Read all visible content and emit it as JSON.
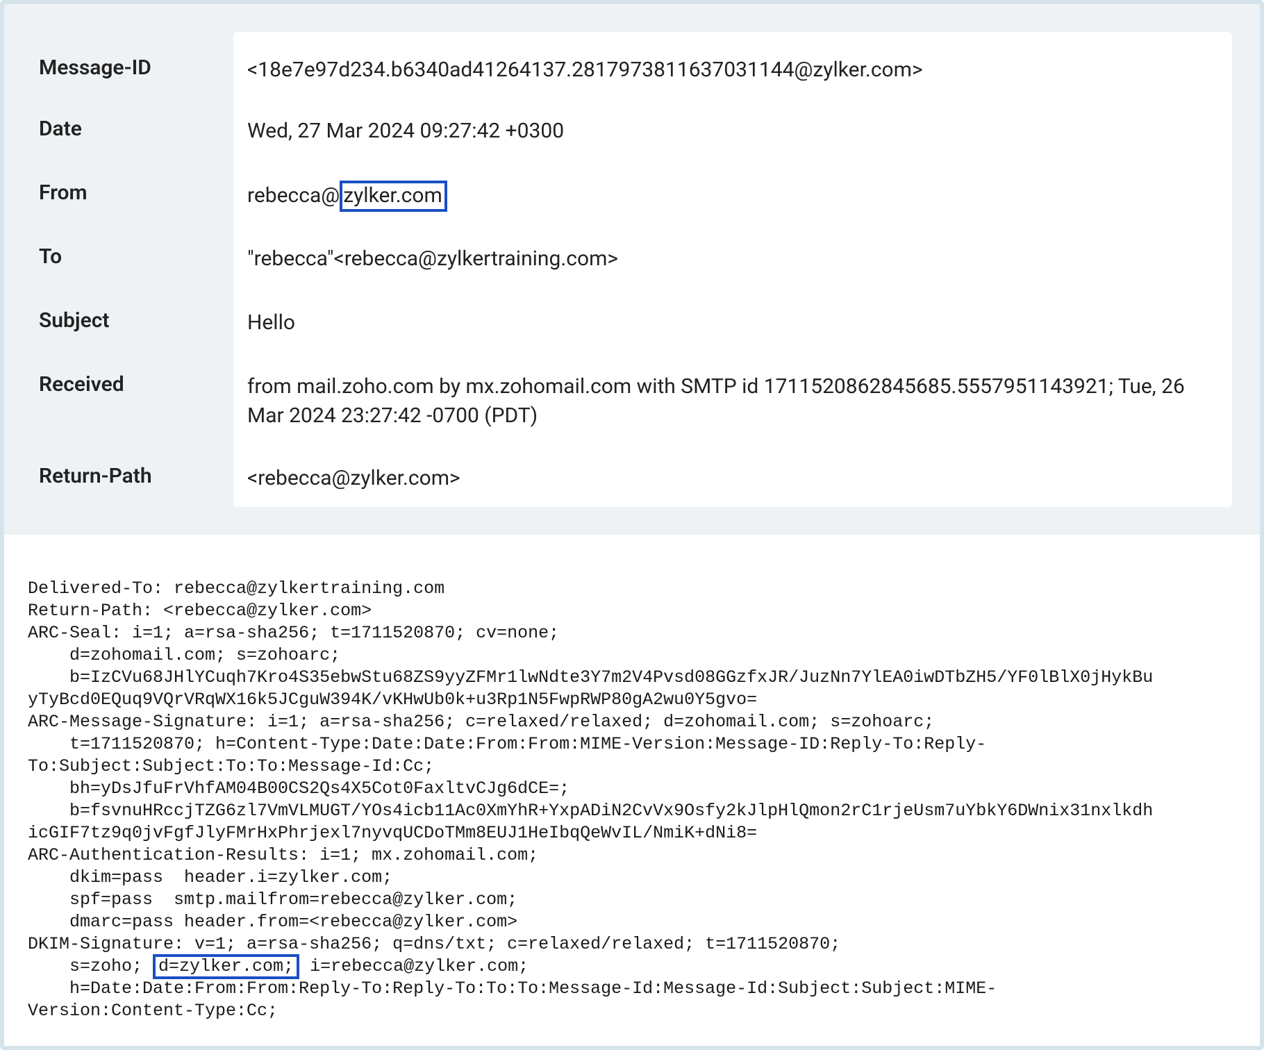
{
  "headers": {
    "message_id": {
      "label": "Message-ID",
      "value": "<18e7e97d234.b6340ad41264137.2817973811637031144@zylker.com>"
    },
    "date": {
      "label": "Date",
      "value": "Wed, 27 Mar 2024 09:27:42 +0300"
    },
    "from": {
      "label": "From",
      "prefix": "rebecca@",
      "highlighted": "zylker.com"
    },
    "to": {
      "label": "To",
      "value": "\"rebecca\"<rebecca@zylkertraining.com>"
    },
    "subject": {
      "label": "Subject",
      "value": "Hello"
    },
    "received": {
      "label": "Received",
      "value": "from mail.zoho.com by mx.zohomail.com with SMTP id 1711520862845685.5557951143921; Tue, 26 Mar 2024 23:27:42 -0700 (PDT)"
    },
    "return_path": {
      "label": "Return-Path",
      "value": "<rebecca@zylker.com>"
    }
  },
  "raw": {
    "l01": "Delivered-To: rebecca@zylkertraining.com",
    "l02": "Return-Path: <rebecca@zylker.com>",
    "l03": "ARC-Seal: i=1; a=rsa-sha256; t=1711520870; cv=none;",
    "l04": "    d=zohomail.com; s=zohoarc;",
    "l05": "    b=IzCVu68JHlYCuqh7Kro4S35ebwStu68ZS9yyZFMr1lwNdte3Y7m2V4Pvsd08GGzfxJR/JuzNn7YlEA0iwDTbZH5/YF0lBlX0jHykBu",
    "l05b": "yTyBcd0EQuq9VQrVRqWX16k5JCguW394K/vKHwUb0k+u3Rp1N5FwpRWP80gA2wu0Y5gvo=",
    "l06": "ARC-Message-Signature: i=1; a=rsa-sha256; c=relaxed/relaxed; d=zohomail.com; s=zohoarc;",
    "l07": "    t=1711520870; h=Content-Type:Date:Date:From:From:MIME-Version:Message-ID:Reply-To:Reply-",
    "l07b": "To:Subject:Subject:To:To:Message-Id:Cc;",
    "l08": "    bh=yDsJfuFrVhfAM04B00CS2Qs4X5Cot0FaxltvCJg6dCE=;",
    "l09": "    b=fsvnuHRccjTZG6zl7VmVLMUGT/YOs4icb11Ac0XmYhR+YxpADiN2CvVx9Osfy2kJlpHlQmon2rC1rjeUsm7uYbkY6DWnix31nxlkdh",
    "l09b": "icGIF7tz9q0jvFgfJlyFMrHxPhrjexl7nyvqUCDoTMm8EUJ1HeIbqQeWvIL/NmiK+dNi8=",
    "l10": "ARC-Authentication-Results: i=1; mx.zohomail.com;",
    "l11": "    dkim=pass  header.i=zylker.com;",
    "l12": "    spf=pass  smtp.mailfrom=rebecca@zylker.com;",
    "l13": "    dmarc=pass header.from=<rebecca@zylker.com>",
    "l14a": "DKIM-Signature: v=1; a=rsa-sha256; q=dns/txt; c=relaxed/relaxed; t=1711520870;",
    "l15a": "    s=zoho; ",
    "l15_highlight": "d=zylker.com;",
    "l15b": " i=rebecca@zylker.com;",
    "l16": "    h=Date:Date:From:From:Reply-To:Reply-To:To:To:Message-Id:Message-Id:Subject:Subject:MIME-",
    "l16b": "Version:Content-Type:Cc;"
  }
}
